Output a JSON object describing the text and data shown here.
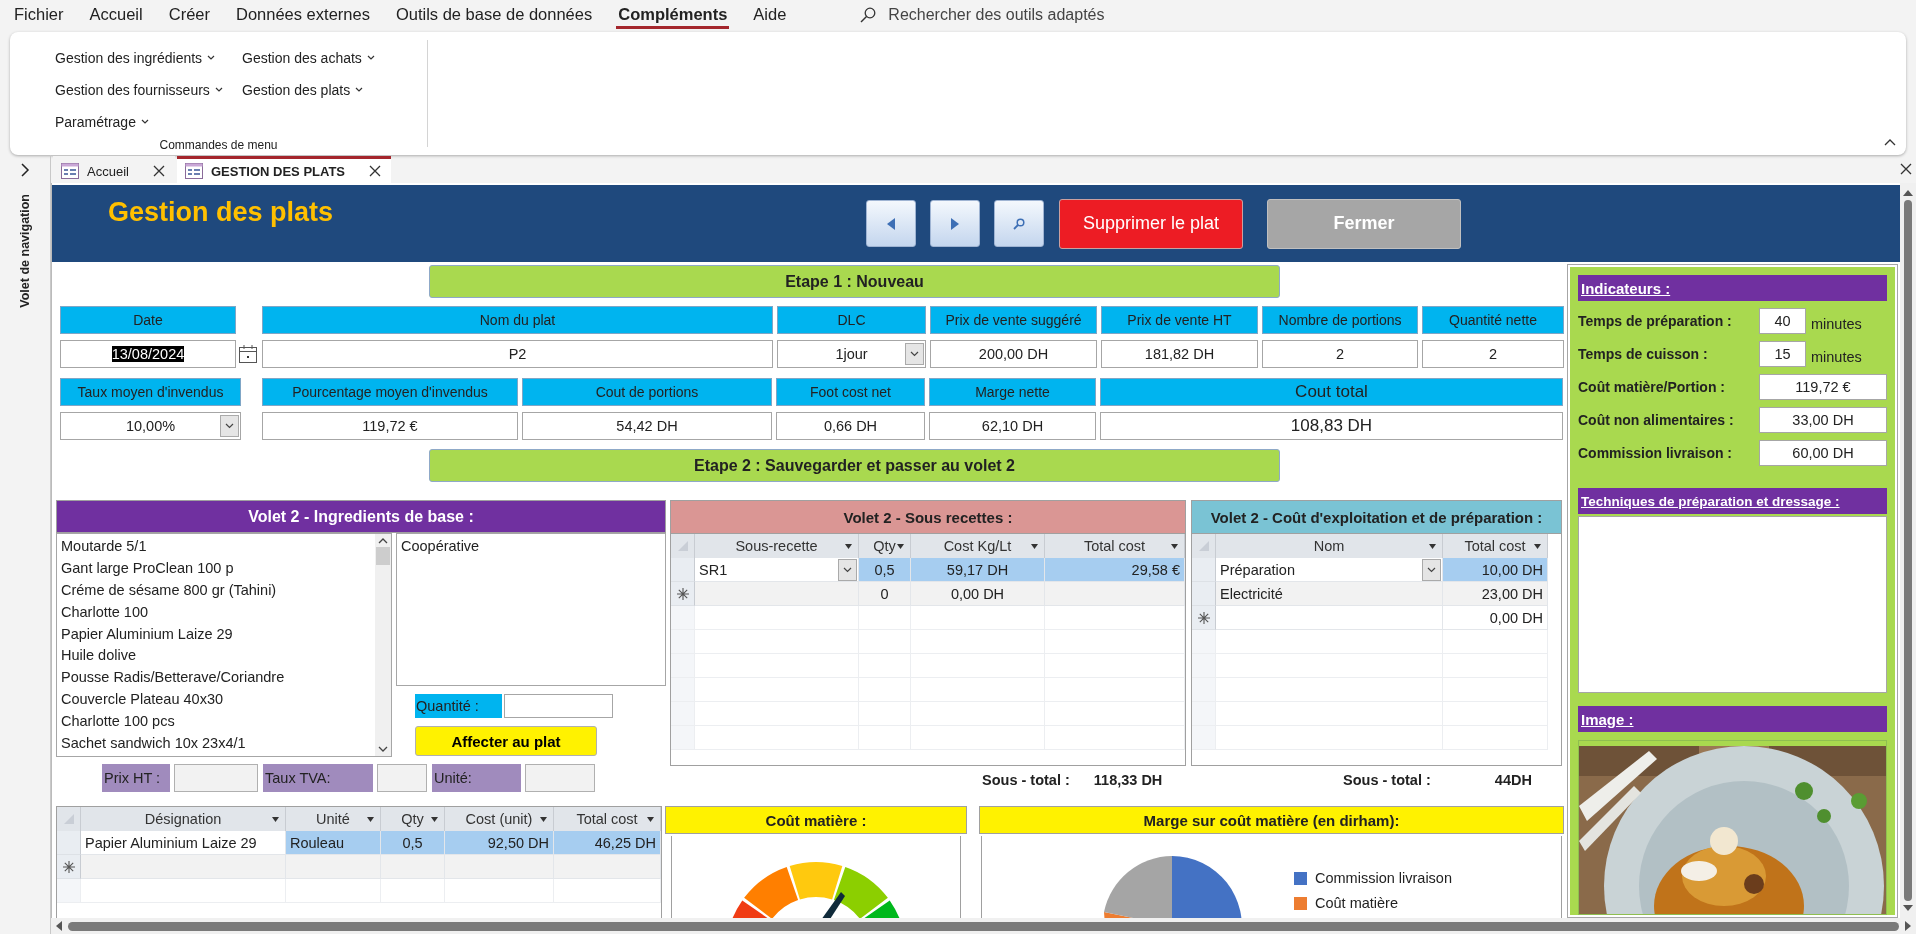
{
  "menu_bar": {
    "items": [
      {
        "label": "Fichier",
        "selected": false
      },
      {
        "label": "Accueil",
        "selected": false
      },
      {
        "label": "Créer",
        "selected": false
      },
      {
        "label": "Données externes",
        "selected": false
      },
      {
        "label": "Outils de base de données",
        "selected": false
      },
      {
        "label": "Compléments",
        "selected": true
      },
      {
        "label": "Aide",
        "selected": false
      }
    ],
    "search_placeholder": "Rechercher des outils adaptés"
  },
  "ribbon": {
    "columns": [
      [
        "Gestion des ingrédients",
        "Gestion des fournisseurs",
        "Paramétrage"
      ],
      [
        "Gestion des achats",
        "Gestion des plats"
      ]
    ],
    "group_label": "Commandes de menu"
  },
  "navigation_pane": {
    "title": "Volet de navigation"
  },
  "document_tabs": [
    {
      "label": "Accueil",
      "selected": false
    },
    {
      "label": "GESTION DES PLATS",
      "selected": true
    }
  ],
  "form": {
    "title": "Gestion des plats",
    "toolbar": [
      {
        "kind": "previous"
      },
      {
        "kind": "next"
      },
      {
        "kind": "search"
      },
      {
        "kind": "delete",
        "label": "Supprimer le plat"
      },
      {
        "kind": "close",
        "label": "Fermer"
      }
    ],
    "step1": "Etape 1 : Nouveau",
    "fields_row_1": [
      {
        "label": "Date",
        "value": "13/08/2024",
        "kind": "date",
        "text_selected": true
      },
      {
        "label": "Nom du plat",
        "value": "P2",
        "kind": "text",
        "text_selected": false
      },
      {
        "label": "DLC",
        "value": "1jour",
        "kind": "dropdown",
        "text_selected": false
      },
      {
        "label": "Prix de vente suggéré",
        "value": "200,00 DH",
        "kind": "text",
        "text_selected": false
      },
      {
        "label": "Prix de vente HT",
        "value": "181,82 DH",
        "kind": "text",
        "text_selected": false
      },
      {
        "label": "Nombre de portions",
        "value": "2",
        "kind": "text",
        "text_selected": false
      },
      {
        "label": "Quantité nette",
        "value": "2",
        "kind": "text",
        "text_selected": false
      }
    ],
    "fields_row_2": [
      {
        "label": "Taux moyen d'invendus",
        "value": "10,00%",
        "kind": "dropdown",
        "text_selected": false
      },
      {
        "label": "Pourcentage moyen d'invendus",
        "value": "119,72 €",
        "kind": "text",
        "text_selected": false
      },
      {
        "label": "Cout de portions",
        "value": "54,42 DH",
        "kind": "text",
        "text_selected": false
      },
      {
        "label": "Foot cost net",
        "value": "0,66 DH",
        "kind": "text",
        "text_selected": false
      },
      {
        "label": "Marge nette",
        "value": "62,10 DH",
        "kind": "text",
        "text_selected": false
      },
      {
        "label": "Cout total",
        "value": "108,83 DH",
        "kind": "large",
        "text_selected": false
      }
    ],
    "step2": "Etape 2 : Sauvegarder et passer au volet 2",
    "ingredients": {
      "title": "Volet 2 - Ingredients de base :",
      "items": [
        "Moutarde 5/1",
        "Gant large ProClean 100 p",
        "Créme de sésame 800 gr (Tahini)",
        "Charlotte 100",
        "Papier Aluminium Laize 29",
        "Huile dolive",
        "Pousse Radis/Betterave/Coriandre",
        "Couvercle Plateau 40x30",
        "Charlotte 100 pcs",
        "Sachet sandwich 10x 23x4/1"
      ],
      "supplier": "Coopérative",
      "quantity_label": "Quantité :",
      "assign_button": "Affecter au plat",
      "info_labels": [
        "Prix HT :",
        "Taux TVA:",
        "Unité:"
      ]
    },
    "sub_recipes": {
      "title": "Volet 2 - Sous recettes :",
      "columns": [
        "Sous-recette",
        "Qty",
        "Cost Kg/Lt",
        "Total cost"
      ],
      "rows": [
        {
          "kind": "record",
          "selected": true,
          "cells": [
            "SR1",
            "0,5",
            "59,17 DH",
            "29,58 €"
          ]
        },
        {
          "kind": "new",
          "selected": false,
          "cells": [
            null,
            "0",
            "0,00 DH",
            null
          ]
        }
      ],
      "subtotal_label": "Sous - total :",
      "subtotal": "118,33 DH"
    },
    "operating_costs": {
      "title": "Volet 2 - Coût d'exploitation et de préparation :",
      "columns": [
        "Nom",
        "Total cost"
      ],
      "rows": [
        {
          "kind": "record",
          "selected": true,
          "cells": [
            "Préparation",
            "10,00 DH"
          ]
        },
        {
          "kind": "record",
          "selected": false,
          "cells": [
            "Electricité",
            "23,00 DH"
          ]
        },
        {
          "kind": "new",
          "selected": false,
          "cells": [
            null,
            "0,00 DH"
          ]
        }
      ],
      "subtotal_label": "Sous - total :",
      "subtotal": "44DH"
    },
    "ingredient_lines": {
      "columns": [
        "Désignation",
        "Unité",
        "Qty",
        "Cost (unit)",
        "Total cost"
      ],
      "rows": [
        {
          "kind": "record",
          "selected": true,
          "cells": [
            "Papier Aluminium Laize 29",
            "Rouleau",
            "0,5",
            "92,50 DH",
            "46,25 DH"
          ]
        },
        {
          "kind": "new",
          "selected": false,
          "cells": [
            null,
            null,
            null,
            null,
            null
          ]
        }
      ]
    },
    "material_cost": {
      "title": "Coût matière :"
    },
    "margin_chart": {
      "title": "Marge sur coût matière (en dirham):",
      "legend": [
        {
          "label": "Commission livraison",
          "color": "#4472c4"
        },
        {
          "label": "Coût matière",
          "color": "#ed7d31"
        }
      ]
    },
    "side_panel": {
      "indicators_title": "Indicateurs :",
      "indicators": [
        {
          "label": "Temps de préparation :",
          "value": "40",
          "unit": "minutes"
        },
        {
          "label": "Temps de cuisson :",
          "value": "15",
          "unit": "minutes"
        },
        {
          "label": "Coût matière/Portion :",
          "value": "119,72 €"
        },
        {
          "label": "Coût non alimentaires :",
          "value": "33,00 DH"
        },
        {
          "label": "Commission livraison :",
          "value": "60,00 DH"
        }
      ],
      "techniques_title": "Techniques de préparation et dressage :",
      "image_title": "Image :"
    }
  }
}
